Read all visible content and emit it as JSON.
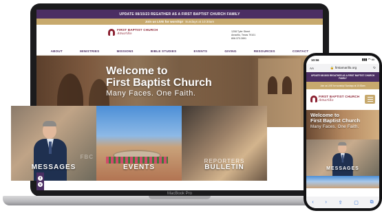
{
  "laptop": {
    "brand": "MacBook Pro",
    "site": {
      "alert": "UPDATE 08/15/23 REGATHER AS A FIRST BAPTIST CHURCH FAMILY",
      "worship_prefix": "Join us LIVE for worship!",
      "worship_suffix": "Sundays at 10:30am",
      "logo_name": "FIRST BAPTIST CHURCH",
      "logo_script": "Amarillo",
      "address": [
        "1208 Tyler Street",
        "Amarillo, Texas 79101",
        "806.373.2891"
      ],
      "nav": [
        "ABOUT",
        "MINISTRIES",
        "MISSIONS",
        "BIBLE STUDIES",
        "EVENTS",
        "GIVING",
        "RESOURCES",
        "CONTACT"
      ],
      "hero_title_1": "Welcome to",
      "hero_title_2": "First Baptist Church",
      "hero_subtitle": "Many Faces. One Faith.",
      "cards": [
        {
          "label": "MESSAGES",
          "ghost": "FBC"
        },
        {
          "label": "EVENTS"
        },
        {
          "label_top": "REPORTERS",
          "label": "BULLETIN"
        }
      ],
      "social": [
        "f",
        "v"
      ]
    }
  },
  "phone": {
    "time": "10:56",
    "status_icons": "▮▮▮ ◠ ▭",
    "aa": "AA",
    "lock": "🔒",
    "url": "firstamarillo.org",
    "reload": "↻",
    "alert": "UPDATE 08/15/23 REGATHER AS A FIRST BAPTIST CHURCH FAMILY",
    "worship": "Join us LIVE for worship! Sundays at 10:30am",
    "logo_name": "FIRST BAPTIST CHURCH",
    "logo_script": "Amarillo",
    "hero_title_1": "Welcome to",
    "hero_title_2": "First Baptist Church",
    "hero_subtitle": "Many Faces. One Faith.",
    "card_label": "MESSAGES",
    "toolbar": [
      "‹",
      "›",
      "⇪",
      "▢",
      "⧉"
    ]
  },
  "colors": {
    "purple": "#4b2e63",
    "gold": "#c7a96d",
    "maroon": "#8c2232"
  }
}
